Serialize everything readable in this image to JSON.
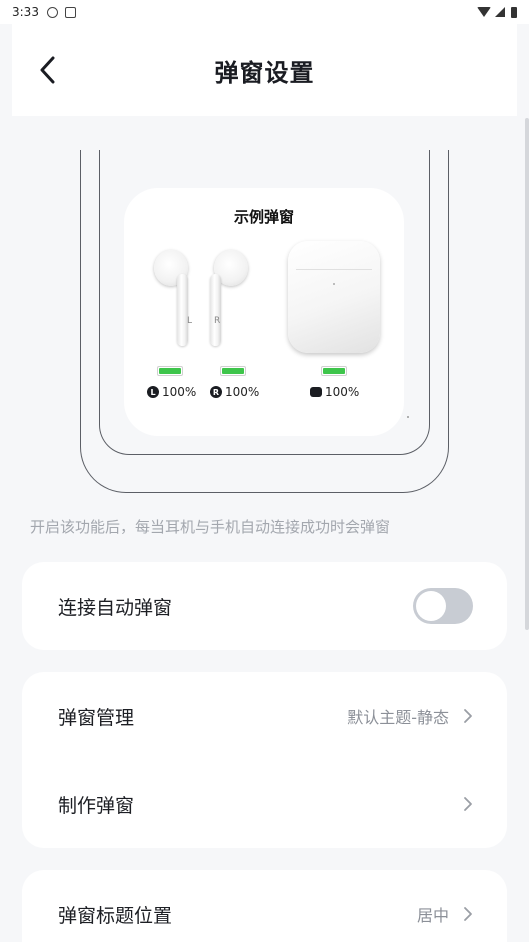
{
  "status_bar": {
    "time": "3:33"
  },
  "header": {
    "title": "弹窗设置"
  },
  "preview": {
    "title": "示例弹窗",
    "left_letter": "L",
    "right_letter": "R",
    "left_badge": "L",
    "right_badge": "R",
    "left_pct": "100%",
    "right_pct": "100%",
    "case_pct": "100%",
    "left_level": 1.0,
    "right_level": 1.0,
    "case_level": 1.0,
    "battery_color": "#3ec54b"
  },
  "description": "开启该功能后，每当耳机与手机自动连接成功时会弹窗",
  "settings": {
    "auto_popup": {
      "label": "连接自动弹窗",
      "enabled": false
    },
    "popup_manage": {
      "label": "弹窗管理",
      "value": "默认主题-静态"
    },
    "make_popup": {
      "label": "制作弹窗"
    },
    "title_position": {
      "label": "弹窗标题位置",
      "value": "居中"
    }
  },
  "colors": {
    "background": "#f6f7f9",
    "card": "#ffffff",
    "toggle_off": "#c8ccd3",
    "secondary_text": "#8c9098"
  }
}
